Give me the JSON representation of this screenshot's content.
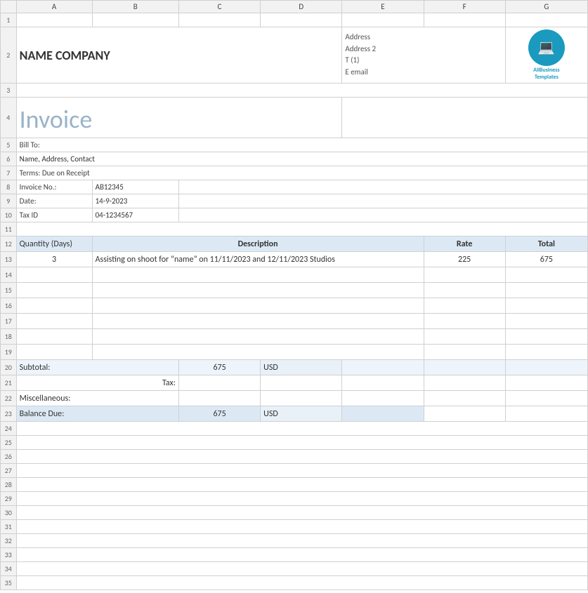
{
  "columns": {
    "letters": [
      "",
      "A",
      "B",
      "C",
      "D",
      "E",
      "F",
      "G"
    ]
  },
  "company": {
    "name": "NAME COMPANY"
  },
  "address": {
    "line1": "Address",
    "line2": "Address 2",
    "line3": "T (1)",
    "line4": "E email"
  },
  "logo": {
    "brand_line1": "AllBusiness",
    "brand_line2": "Templates"
  },
  "invoice": {
    "heading": "Invoice"
  },
  "bill_to": {
    "label": "Bill To:",
    "value": "Name, Address, Contact"
  },
  "terms": {
    "label": "Terms: Due on Receipt"
  },
  "fields": {
    "invoice_no_label": "Invoice No.:",
    "invoice_no_value": "AB12345",
    "date_label": "Date:",
    "date_value": "14-9-2023",
    "tax_id_label": "Tax ID",
    "tax_id_value": "04-1234567"
  },
  "table": {
    "header": {
      "quantity": "Quantity (Days)",
      "description": "Description",
      "rate": "Rate",
      "total": "Total"
    },
    "rows": [
      {
        "quantity": "3",
        "description": "Assisting on shoot for “name” on 11/11/2023 and 12/11/2023 Studios",
        "rate": "225",
        "total": "675"
      }
    ]
  },
  "summary": {
    "subtotal_label": "Subtotal:",
    "subtotal_value": "675",
    "subtotal_currency": "USD",
    "tax_label": "Tax:",
    "misc_label": "Miscellaneous:",
    "balance_label": "Balance Due:",
    "balance_value": "675",
    "balance_currency": "USD"
  },
  "rows": {
    "numbers": [
      "1",
      "2",
      "3",
      "4",
      "5",
      "6",
      "7",
      "8",
      "9",
      "10",
      "11",
      "12",
      "13",
      "14",
      "15",
      "16",
      "17",
      "18",
      "19",
      "20",
      "21",
      "22",
      "23",
      "24",
      "25",
      "26",
      "27",
      "28",
      "29",
      "30",
      "31",
      "32",
      "33",
      "34",
      "35"
    ]
  }
}
